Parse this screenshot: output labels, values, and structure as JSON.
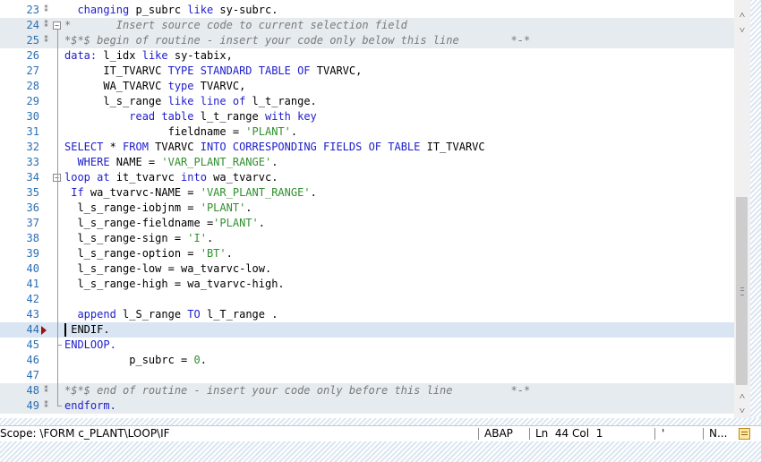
{
  "editor": {
    "lines": [
      {
        "no": "23",
        "segs": [
          {
            "c": "kw",
            "t": "  changing "
          },
          {
            "c": "tx",
            "t": "p_subrc "
          },
          {
            "c": "kw",
            "t": "like "
          },
          {
            "c": "tx",
            "t": "sy-subrc."
          }
        ]
      },
      {
        "no": "24",
        "segs": [
          {
            "c": "cm",
            "t": "*       Insert source code to current selection field"
          }
        ]
      },
      {
        "no": "25",
        "segs": [
          {
            "c": "cm",
            "t": "*$*$ begin of routine - insert your code only below this line        *-*"
          }
        ]
      },
      {
        "no": "26",
        "segs": [
          {
            "c": "kw",
            "t": "data: "
          },
          {
            "c": "tx",
            "t": "l_idx "
          },
          {
            "c": "kw",
            "t": "like "
          },
          {
            "c": "tx",
            "t": "sy-tabix,"
          }
        ]
      },
      {
        "no": "27",
        "segs": [
          {
            "c": "tx",
            "t": "      IT_TVARVC "
          },
          {
            "c": "kw",
            "t": "TYPE STANDARD TABLE OF "
          },
          {
            "c": "tx",
            "t": "TVARVC,"
          }
        ]
      },
      {
        "no": "28",
        "segs": [
          {
            "c": "tx",
            "t": "      WA_TVARVC "
          },
          {
            "c": "kw",
            "t": "type "
          },
          {
            "c": "tx",
            "t": "TVARVC,"
          }
        ]
      },
      {
        "no": "29",
        "segs": [
          {
            "c": "tx",
            "t": "      l_s_range "
          },
          {
            "c": "kw",
            "t": "like line of "
          },
          {
            "c": "tx",
            "t": "l_t_range."
          }
        ]
      },
      {
        "no": "30",
        "segs": [
          {
            "c": "kw",
            "t": "          read table "
          },
          {
            "c": "tx",
            "t": "l_t_range "
          },
          {
            "c": "kw",
            "t": "with key"
          }
        ]
      },
      {
        "no": "31",
        "segs": [
          {
            "c": "tx",
            "t": "                fieldname = "
          },
          {
            "c": "str",
            "t": "'PLANT'"
          },
          {
            "c": "tx",
            "t": "."
          }
        ]
      },
      {
        "no": "32",
        "segs": [
          {
            "c": "kw",
            "t": "SELECT "
          },
          {
            "c": "tx",
            "t": "* "
          },
          {
            "c": "kw",
            "t": "FROM "
          },
          {
            "c": "tx",
            "t": "TVARVC "
          },
          {
            "c": "kw",
            "t": "INTO CORRESPONDING FIELDS OF TABLE "
          },
          {
            "c": "tx",
            "t": "IT_TVARVC"
          }
        ]
      },
      {
        "no": "33",
        "segs": [
          {
            "c": "kw",
            "t": "  WHERE "
          },
          {
            "c": "tx",
            "t": "NAME = "
          },
          {
            "c": "str",
            "t": "'VAR_PLANT_RANGE'"
          },
          {
            "c": "tx",
            "t": "."
          }
        ]
      },
      {
        "no": "34",
        "segs": [
          {
            "c": "kw",
            "t": "loop at "
          },
          {
            "c": "tx",
            "t": "it_tvarvc "
          },
          {
            "c": "kw",
            "t": "into "
          },
          {
            "c": "tx",
            "t": "wa_tvarvc."
          }
        ]
      },
      {
        "no": "35",
        "segs": [
          {
            "c": "kw",
            "t": " If "
          },
          {
            "c": "tx",
            "t": "wa_tvarvc-NAME = "
          },
          {
            "c": "str",
            "t": "'VAR_PLANT_RANGE'"
          },
          {
            "c": "tx",
            "t": "."
          }
        ]
      },
      {
        "no": "36",
        "segs": [
          {
            "c": "tx",
            "t": "  l_s_range-iobjnm = "
          },
          {
            "c": "str",
            "t": "'PLANT'"
          },
          {
            "c": "tx",
            "t": "."
          }
        ]
      },
      {
        "no": "37",
        "segs": [
          {
            "c": "tx",
            "t": "  l_s_range-fieldname ="
          },
          {
            "c": "str",
            "t": "'PLANT'"
          },
          {
            "c": "tx",
            "t": "."
          }
        ]
      },
      {
        "no": "38",
        "segs": [
          {
            "c": "tx",
            "t": "  l_s_range-sign = "
          },
          {
            "c": "str",
            "t": "'I'"
          },
          {
            "c": "tx",
            "t": "."
          }
        ]
      },
      {
        "no": "39",
        "segs": [
          {
            "c": "tx",
            "t": "  l_s_range-option = "
          },
          {
            "c": "str",
            "t": "'BT'"
          },
          {
            "c": "tx",
            "t": "."
          }
        ]
      },
      {
        "no": "40",
        "segs": [
          {
            "c": "tx",
            "t": "  l_s_range-low = wa_tvarvc-low."
          }
        ]
      },
      {
        "no": "41",
        "segs": [
          {
            "c": "tx",
            "t": "  l_s_range-high = wa_tvarvc-high."
          }
        ]
      },
      {
        "no": "42",
        "segs": []
      },
      {
        "no": "43",
        "segs": [
          {
            "c": "kw",
            "t": "  append "
          },
          {
            "c": "tx",
            "t": "l_S_range "
          },
          {
            "c": "kw",
            "t": "TO "
          },
          {
            "c": "tx",
            "t": "l_T_range ."
          }
        ]
      },
      {
        "no": "44",
        "segs": [
          {
            "c": "tx",
            "t": " ENDIF."
          }
        ]
      },
      {
        "no": "45",
        "segs": [
          {
            "c": "kw",
            "t": "ENDLOOP."
          }
        ]
      },
      {
        "no": "46",
        "segs": [
          {
            "c": "tx",
            "t": "          p_subrc = "
          },
          {
            "c": "str",
            "t": "0"
          },
          {
            "c": "tx",
            "t": "."
          }
        ]
      },
      {
        "no": "47",
        "segs": []
      },
      {
        "no": "48",
        "segs": [
          {
            "c": "cm",
            "t": "*$*$ end of routine - insert your code only before this line         *-*"
          }
        ]
      },
      {
        "no": "49",
        "segs": [
          {
            "c": "kw",
            "t": "endform."
          }
        ]
      }
    ],
    "current_line": "44"
  },
  "scrollbar": {
    "up_icon": "chevron-up-icon",
    "down_icon": "chevron-down-icon",
    "up_glyph": "˄",
    "down_glyph": "˅"
  },
  "status": {
    "scope": "Scope: \\FORM c_PLANT\\LOOP\\IF",
    "language": "ABAP",
    "position": "Ln  44 Col  1",
    "mode_short": "'",
    "mode": "N..."
  }
}
